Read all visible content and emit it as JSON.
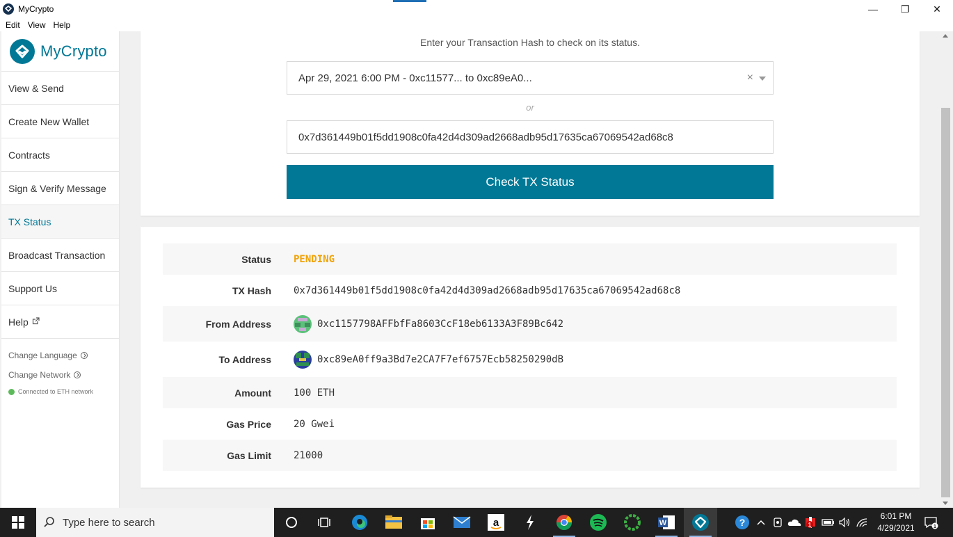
{
  "window": {
    "title": "MyCrypto",
    "minimize": "—",
    "restore": "❐",
    "close": "✕"
  },
  "menu": [
    "Edit",
    "View",
    "Help"
  ],
  "sidebar": {
    "brand": "MyCrypto",
    "items": [
      {
        "label": "View & Send"
      },
      {
        "label": "Create New Wallet"
      },
      {
        "label": "Contracts"
      },
      {
        "label": "Sign & Verify Message"
      },
      {
        "label": "TX Status",
        "active": true
      },
      {
        "label": "Broadcast Transaction"
      },
      {
        "label": "Support Us"
      },
      {
        "label": "Help",
        "external": true
      }
    ],
    "change_language": "Change Language",
    "change_network": "Change Network",
    "connection": "Connected to ETH network"
  },
  "lookup": {
    "hint": "Enter your Transaction Hash to check on its status.",
    "recent_select": "Apr 29, 2021 6:00 PM - 0xc11577... to 0xc89eA0...",
    "or": "or",
    "hash_value": "0x7d361449b01f5dd1908c0fa42d4d309ad2668adb95d17635ca67069542ad68c8",
    "button": "Check TX Status"
  },
  "details": {
    "status_label": "Status",
    "status": "PENDING",
    "hash_label": "TX Hash",
    "hash": "0x7d361449b01f5dd1908c0fa42d4d309ad2668adb95d17635ca67069542ad68c8",
    "from_label": "From Address",
    "from": "0xc1157798AFFbfFa8603CcF18eb6133A3F89Bc642",
    "to_label": "To Address",
    "to": "0xc89eA0ff9a3Bd7e2CA7F7ef6757Ecb58250290dB",
    "amount_label": "Amount",
    "amount": "100 ETH",
    "gas_price_label": "Gas Price",
    "gas_price": "20 Gwei",
    "gas_limit_label": "Gas Limit",
    "gas_limit": "21000"
  },
  "taskbar": {
    "search_placeholder": "Type here to search",
    "time": "6:01 PM",
    "date": "4/29/2021",
    "notifications": "1",
    "security_badge": "1"
  },
  "colors": {
    "accent": "#007896",
    "pending": "#f0a30a",
    "connected": "#5dba5b"
  }
}
